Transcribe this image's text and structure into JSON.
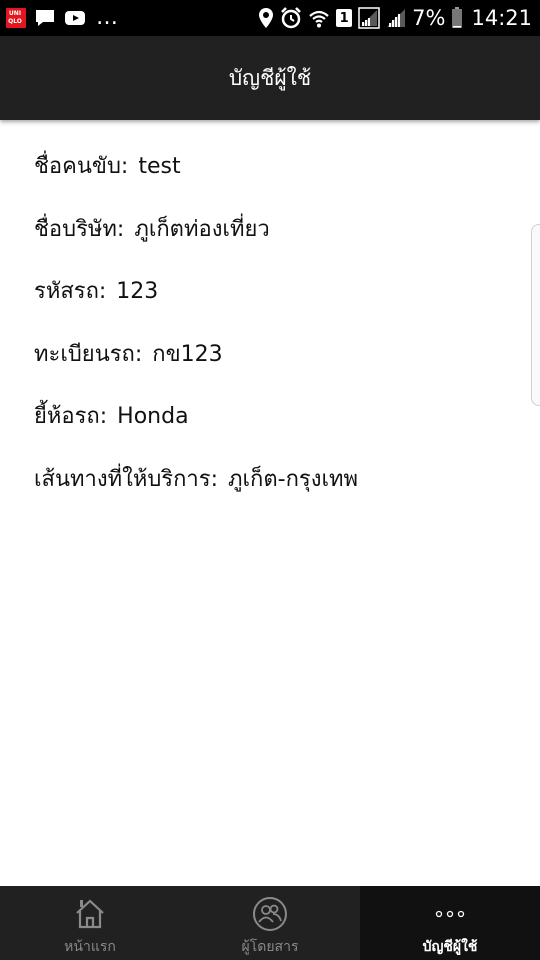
{
  "status_bar": {
    "battery_percent": "7%",
    "time": "14:21",
    "sim_slot": "1",
    "app_badge_text": "UNI QLO"
  },
  "header": {
    "title": "บัญชีผู้ใช้"
  },
  "details": [
    {
      "label": "ชื่อคนขับ:",
      "value": "test"
    },
    {
      "label": "ชื่อบริษัท:",
      "value": "ภูเก็ตท่องเที่ยว"
    },
    {
      "label": "รหัสรถ:",
      "value": "123"
    },
    {
      "label": "ทะเบียนรถ:",
      "value": "กข123"
    },
    {
      "label": "ยี้ห้อรถ:",
      "value": "Honda"
    },
    {
      "label": "เส้นทางที่ให้บริการ:",
      "value": "ภูเก็ต-กรุงเทพ"
    }
  ],
  "bottom_nav": {
    "items": [
      {
        "label": "หน้าแรก",
        "icon": "home-icon",
        "active": false
      },
      {
        "label": "ผู้โดยสาร",
        "icon": "passengers-icon",
        "active": false
      },
      {
        "label": "บัญชีผู้ใช้",
        "icon": "more-dots-icon",
        "active": true
      }
    ]
  }
}
